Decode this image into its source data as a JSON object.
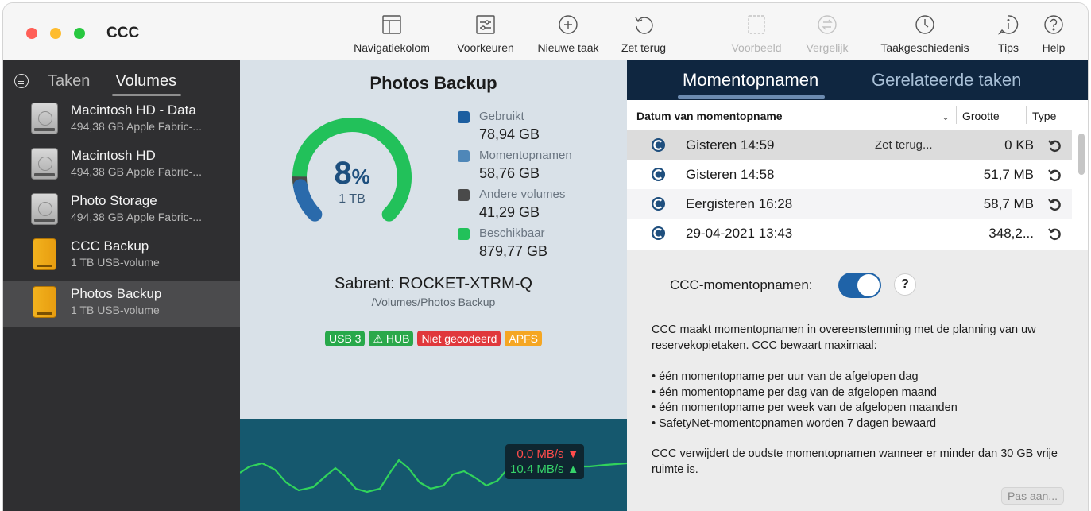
{
  "app": {
    "title": "CCC"
  },
  "toolbar": [
    {
      "label": "Navigatiekolom",
      "icon": "sidebar-icon",
      "enabled": true
    },
    {
      "label": "Voorkeuren",
      "icon": "sliders-icon",
      "enabled": true
    },
    {
      "label": "Nieuwe taak",
      "icon": "plus-circle-icon",
      "enabled": true
    },
    {
      "label": "Zet terug",
      "icon": "restore-icon",
      "enabled": true
    },
    {
      "label": "Voorbeeld",
      "icon": "preview-icon",
      "enabled": false
    },
    {
      "label": "Vergelijk",
      "icon": "compare-icon",
      "enabled": false
    },
    {
      "label": "Taakgeschiedenis",
      "icon": "clock-icon",
      "enabled": true
    },
    {
      "label": "Tips",
      "icon": "tips-icon",
      "enabled": true
    },
    {
      "label": "Help",
      "icon": "help-icon",
      "enabled": true
    }
  ],
  "sidebar": {
    "tabs": {
      "tasks": "Taken",
      "volumes": "Volumes"
    },
    "volumes": [
      {
        "name": "Macintosh HD - Data",
        "sub": "494,38 GB Apple Fabric-...",
        "kind": "internal"
      },
      {
        "name": "Macintosh HD",
        "sub": "494,38 GB Apple Fabric-...",
        "kind": "internal"
      },
      {
        "name": "Photo Storage",
        "sub": "494,38 GB Apple Fabric-...",
        "kind": "internal"
      },
      {
        "name": "CCC Backup",
        "sub": "1 TB USB-volume",
        "kind": "external"
      },
      {
        "name": "Photos Backup",
        "sub": "1 TB USB-volume",
        "kind": "external",
        "selected": true
      }
    ]
  },
  "volume": {
    "title": "Photos Backup",
    "usage_percent": "8",
    "usage_unit": "%",
    "capacity": "1 TB",
    "usage": {
      "used": 78.94,
      "snapshots": 58.76,
      "other": 41.29,
      "free": 879.77
    },
    "legend": [
      {
        "label": "Gebruikt",
        "value": "78,94 GB",
        "color": "#1c5ea0"
      },
      {
        "label": "Momentopnamen",
        "value": "58,76 GB",
        "color": "#4f87b8"
      },
      {
        "label": "Andere volumes",
        "value": "41,29 GB",
        "color": "#4a4a4a"
      },
      {
        "label": "Beschikbaar",
        "value": "879,77 GB",
        "color": "#22c15a"
      }
    ],
    "device_name": "Sabrent: ROCKET-XTRM-Q",
    "path": "/Volumes/Photos Backup",
    "badges": [
      {
        "label": "USB 3",
        "color": "#27a84a"
      },
      {
        "label": "⚠ HUB",
        "color": "#2ba84b"
      },
      {
        "label": "Niet gecodeerd",
        "color": "#e0383c"
      },
      {
        "label": "APFS",
        "color": "#f5a623"
      }
    ],
    "speed": {
      "read": "0.0 MB/s ▼",
      "write": "10.4 MB/s ▲"
    }
  },
  "right_panel": {
    "tabs": {
      "snapshots": "Momentopnamen",
      "related": "Gerelateerde taken"
    },
    "columns": {
      "date": "Datum van momentopname",
      "size": "Grootte",
      "type": "Type"
    },
    "snapshots": [
      {
        "date": "Gisteren 14:59",
        "action": "Zet terug...",
        "size": "0 KB"
      },
      {
        "date": "Gisteren 14:58",
        "action": "",
        "size": "51,7 MB"
      },
      {
        "date": "Eergisteren 16:28",
        "action": "",
        "size": "58,7 MB"
      },
      {
        "date": "29-04-2021 13:43",
        "action": "",
        "size": "348,2..."
      }
    ],
    "switch_label": "CCC-momentopnamen:",
    "switch_on": true,
    "help": "?",
    "info_intro": "CCC maakt momentopnamen in overeenstemming met de planning van uw reservekopietaken. CCC bewaart maximaal:",
    "bullets": [
      "• één momentopname per uur van de afgelopen dag",
      "• één momentopname per dag van de afgelopen maand",
      "• één momentopname per week van de afgelopen maanden",
      "• SafetyNet-momentopnamen worden 7 dagen bewaard"
    ],
    "info_footer": "CCC verwijdert de oudste momentopnamen wanneer er minder dan 30 GB vrije ruimte is.",
    "adjust_button": "Pas aan..."
  }
}
